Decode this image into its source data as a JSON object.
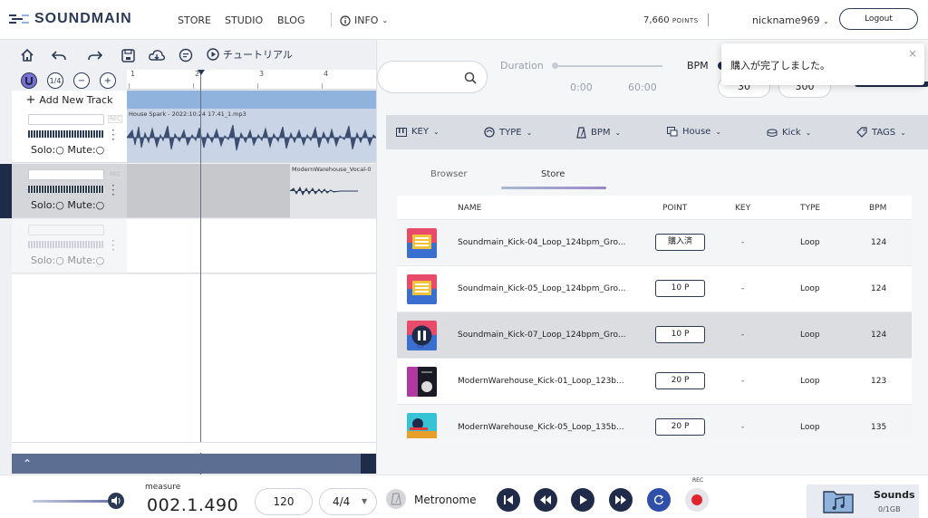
{
  "nav": {
    "brand": "SOUNDMAIN",
    "links": [
      "STORE",
      "STUDIO",
      "BLOG",
      "INFO"
    ],
    "points_value": "7,660",
    "points_unit": "POINTS",
    "username": "nickname969",
    "logout": "Logout"
  },
  "toast": {
    "message": "購入が完了しました。",
    "close": "×"
  },
  "editor": {
    "tutorial": "チュートリアル",
    "snap": "1/4",
    "add_track": "Add New Track",
    "ruler_ticks": [
      "1",
      "2",
      "3",
      "4"
    ],
    "tracks": [
      {
        "solo": "Solo:",
        "mute": "Mute:",
        "rec": "REC",
        "clip": "House Spark - 2022:10:24 17.41_1.mp3"
      },
      {
        "solo": "Solo:",
        "mute": "Mute:",
        "rec": "REC",
        "clip": "ModernWarehouse_Vocal-0"
      },
      {
        "solo": "Solo:",
        "mute": "Mute:",
        "rec": "",
        "clip": ""
      }
    ]
  },
  "store": {
    "search_placeholder": "",
    "duration_label": "Duration",
    "duration_min": "0:00",
    "duration_max": "60:00",
    "bpm_label": "BPM",
    "bpm_min": "30",
    "bpm_max": "300",
    "filters": [
      "KEY",
      "TYPE",
      "BPM",
      "House",
      "Kick",
      "TAGS"
    ],
    "tabs": [
      "Browser",
      "Store"
    ],
    "active_tab": "Store",
    "columns": [
      "NAME",
      "POINT",
      "KEY",
      "TYPE",
      "BPM"
    ],
    "rows": [
      {
        "name": "Soundmain_Kick-04_Loop_124bpm_Gro...",
        "point": "購入済",
        "key": "-",
        "type": "Loop",
        "bpm": "124",
        "thumb": "groovy"
      },
      {
        "name": "Soundmain_Kick-05_Loop_124bpm_Gro...",
        "point": "10 P",
        "key": "-",
        "type": "Loop",
        "bpm": "124",
        "thumb": "groovy"
      },
      {
        "name": "Soundmain_Kick-07_Loop_124bpm_Gro...",
        "point": "10 P",
        "key": "-",
        "type": "Loop",
        "bpm": "124",
        "thumb": "pause"
      },
      {
        "name": "ModernWarehouse_Kick-01_Loop_123b...",
        "point": "20 P",
        "key": "-",
        "type": "Loop",
        "bpm": "123",
        "thumb": "dark"
      },
      {
        "name": "ModernWarehouse_Kick-05_Loop_135b...",
        "point": "20 P",
        "key": "-",
        "type": "Loop",
        "bpm": "135",
        "thumb": "cyan"
      }
    ]
  },
  "transport": {
    "measure_label": "measure",
    "measure_value": "002.1.490",
    "tempo": "120",
    "time_signature": "4/4",
    "metronome": "Metronome",
    "rec_label": "REC",
    "sounds_label": "Sounds",
    "sounds_capacity": "0/1GB"
  },
  "colors": {
    "accent": "#1f2b49",
    "clip_blue": "#8fb3dd",
    "rec_red": "#e0252e"
  }
}
